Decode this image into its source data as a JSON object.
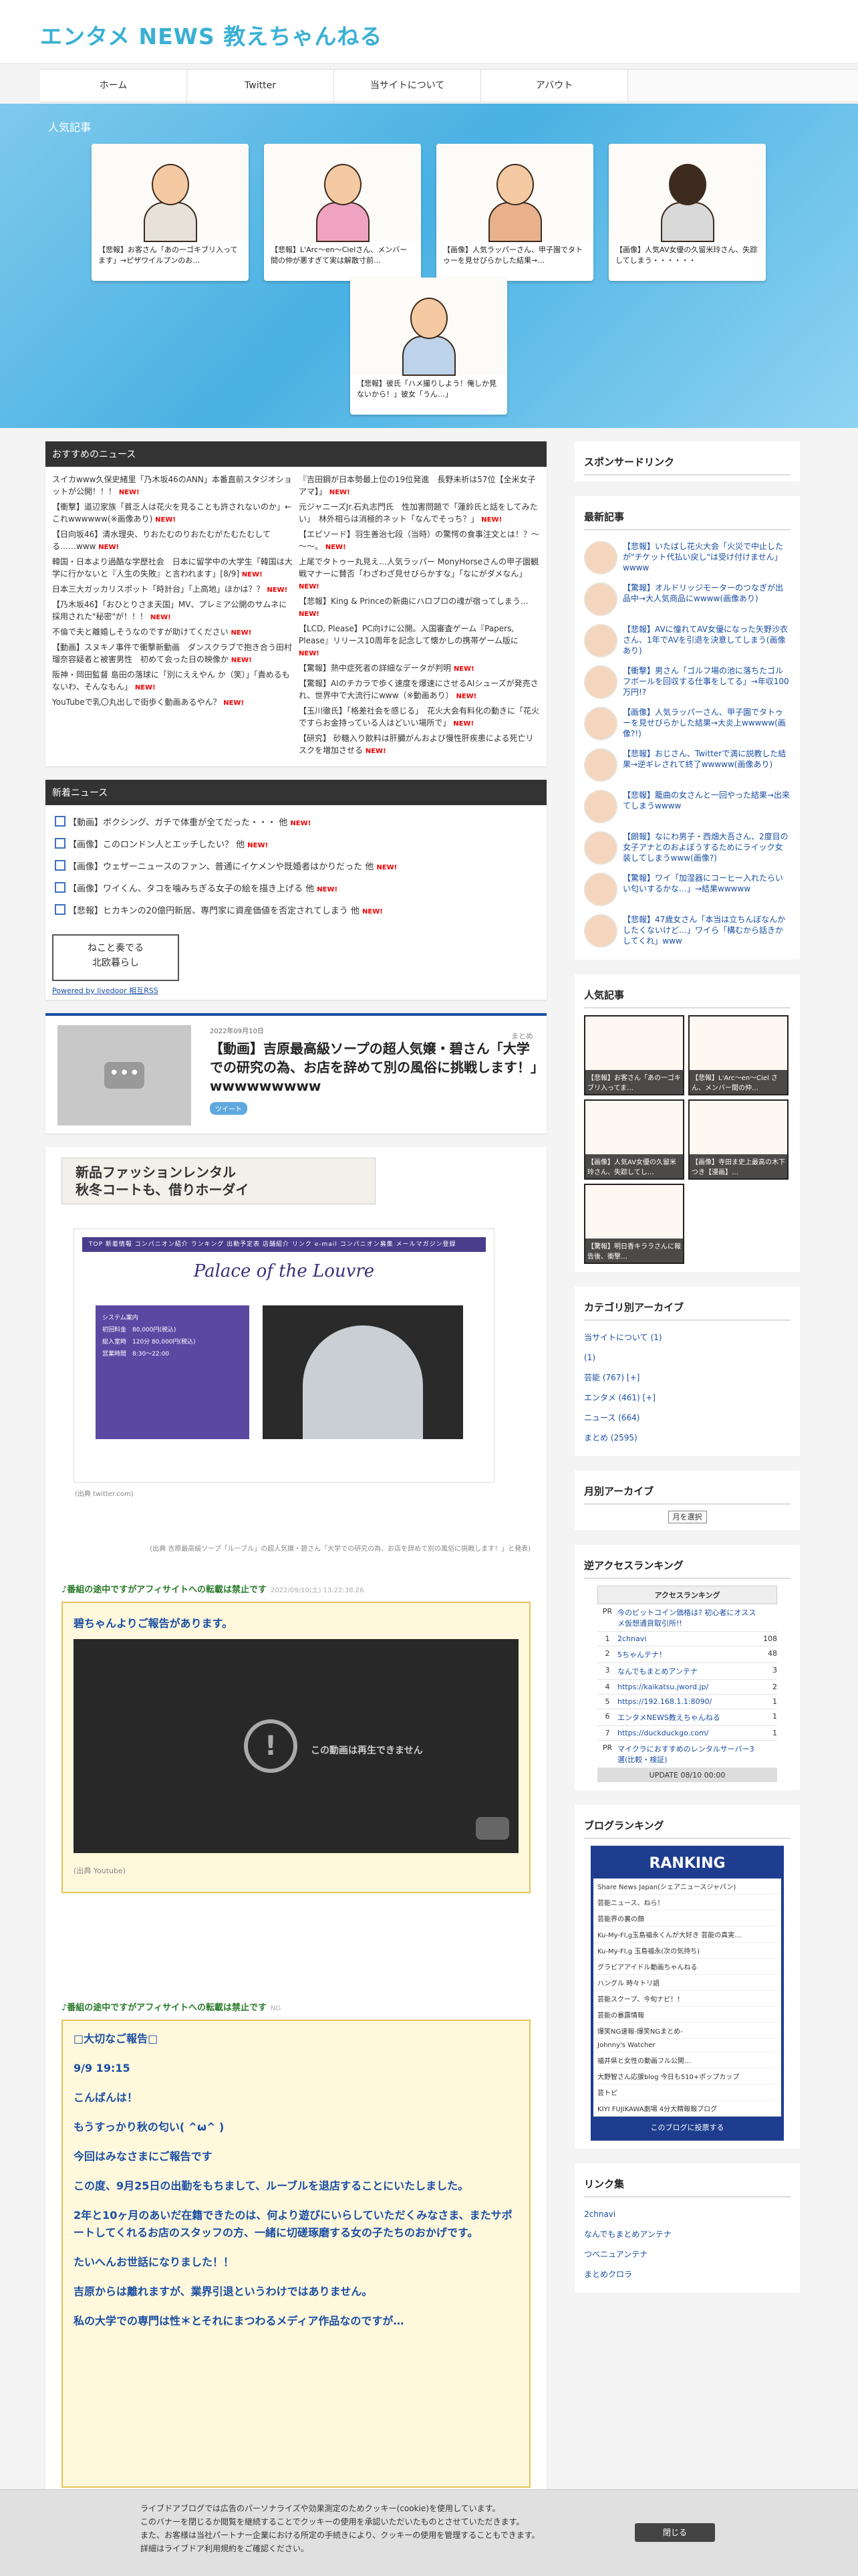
{
  "site": {
    "title": "エンタメ NEWS 教えちゃんねる"
  },
  "nav": [
    "ホーム",
    "Twitter",
    "当サイトについて",
    "アバウト"
  ],
  "hero": {
    "title": "人気記事",
    "cards": [
      "【悲報】お客さん「あの一ゴキブリ入ってます」→ピザワイルプンのお…",
      "【悲報】L'Arc～en～Cielさん、メンバー間の仲が悪すぎて実は解散寸前…",
      "【画像】人気ラッパーさん、甲子園でタトゥーを見せびらかした結果→…",
      "【画像】人気AV女優の久留米玲さん、失踪してしまう・・・・・・",
      "【悲報】彼氏「ハメ撮りしよう！俺しか見ないから！」彼女「うん…」"
    ]
  },
  "osusume": {
    "title": "おすすめのニュース",
    "col1": [
      "スイカwww久保史緒里「乃木坂46のANN」本番直前スタジオショットが公開！！！",
      "【衝撃】道辺家族「貧乏人は花火を見ることも許されないのか」←これwwwwww(※画像あり)",
      "【日向坂46】清水理央、りおたむのりおたむがたむたむしてる……www",
      "韓国・日本より過酷な学歴社会　日本に留学中の大学生「韓国は大学に行かないと『人生の失敗』と言われます」[8/9]",
      "日本三大ガッカリスポット「時計台」「上高地」ほかは？？",
      "【乃木坂46】「おひとりさま天国」MV、プレミア公開のサムネに採用された\"秘密\"が！！！",
      "不倫で夫と離婚しそうなのですが助けてください",
      "【動画】スヌキノ事件で衝撃新動画　ダンスクラブで抱き合う田村瑠奈容疑者と被害男性　初めて会った日の映像か",
      "阪神・岡田監督 島田の落球に「別にええやん か（笑）」「責めるもないわ、そんなもん」",
      "YouTubeで乳〇丸出しで街歩く動画あるやん？"
    ],
    "col2": [
      "『吉田鋼が日本勢最上位の19位発進　長野未祈は57位【全米女子アマ】」",
      "元ジャニーズJr.石丸志門氏　性加害問題で「蓮鈴氏と話をしてみたい」　林外相らは消極的ネット「なんでそっち？」",
      "【エピソード】羽生善治七段（当時）の驚愕の食事注文とは！？～～～。",
      "上尾でタトゥー丸見え…人気ラッパー MonyHorseさんの甲子園観戦マナーに賛否「わざわざ見せびらかすな」「なにがダメなん」",
      "【悲報】King & Princeの新曲にハロプロの魂が宿ってしまう…",
      "【LCD, Please】PC向けに公開。入国審査ゲーム『Papers, Please』リリース10周年を記念して懐かしの携帯ゲーム版に",
      "【驚報】熱中症死者の詳細なデータが判明",
      "【驚報】AIのチカラで歩く速度を爆速にさせるAIシューズが発売され、世界中で大流行にwww（※動画あり）",
      "【玉川徹氏】「格差社会を感じる」　花火大会有料化の動きに「花火ですらお金持っている人はどいい場所で」",
      "【研究】 砂糖入り飲料は肝臓がんおよび慢性肝疾患による死亡リスクを増加させる"
    ],
    "new_label": "NEW!"
  },
  "shinchaku": {
    "title": "新着ニュース",
    "items": [
      "【動画】ボクシング、ガチで体重が全てだった・・・ 他",
      "【画像】このロンドン人とエッチしたい？ 他",
      "【画像】ウェザーニュースのファン、普通にイケメンや既婚者はかりだった 他",
      "【画像】ワイくん、タコを噛みちぎる女子の絵を描き上げる 他",
      "【悲報】ヒカキンの20億円新居、専門家に資産価値を否定されてしまう 他"
    ],
    "banner": "ねこと奏でる\n北欧暮らし",
    "powered": "Powered by livedoor 相互RSS"
  },
  "post": {
    "date": "2022年09月10日",
    "category": "まとめ",
    "title": "【動画】吉原最高級ソープの超人気嬢・碧さん「大学での研究の為、お店を辞めて別の風俗に挑戦します！」wwwwwwwww",
    "tweet": "ツイート"
  },
  "article": {
    "ad": "新品ファッションレンタル\n秋冬コートも、借りホーダイ",
    "shot_caption": "(出典 twitter.com)",
    "shop_bar": "TOP  新着情報  コンパニオン紹介  ランキング  出勤予定表  店舗紹介  リンク  e-mail  コンパニオン募集  メールマガジン登録",
    "shop_logo": "Palace of the Louvre",
    "shop_info": "システム案内\n初回料金　80,000円(税込)\n総入室時　120分 80,000円(税込)\n営業時間　8:30～22:00",
    "caption1": "(出典 吉原最高級ソープ「ルーブル」の超人気嬢・碧さん「大学での研究の為、お店を辞めて別の風俗に挑戦します！」と発表)",
    "notice1": "♪番組の途中ですがアフィサイトへの転載は禁止です",
    "time1": "2022/09/10(土) 13:22:38.26",
    "yellow1_title": "碧ちゃんよりご報告があります。",
    "video_text": "この動画は再生できません",
    "video_src": "(出典 Youtube)",
    "notice2": "♪番組の途中ですがアフィサイトへの転載は禁止です",
    "time2": "NG",
    "yellow2": [
      "□大切なご報告□",
      "9/9 19:15",
      "こんばんは！",
      "もうすっかり秋の匂い( ^ω^ )",
      "今回はみなさまにご報告です",
      "この度、9月25日の出勤をもちまして、ルーブルを退店することにいたしました。",
      "2年と10ヶ月のあいだ在籍できたのは、何より遊びにいらしていただくみなさま、またサポートしてくれるお店のスタッフの方、一緒に切磋琢磨する女の子たちのおかげです。",
      "たいへんお世話になりました！！",
      "吉原からは離れますが、業界引退というわけではありません。",
      "私の大学での専門は性＊とそれにまつわるメディア作品なのですが…"
    ]
  },
  "sidebar": {
    "sponsor": "スポンサードリンク",
    "latest": "最新記事",
    "latest_items": [
      "【悲報】いたばし花火大会「火災で中止したが\"チケット代払い戻し\"は受け付けません」wwww",
      "【驚報】オルドリッジモーターのつなぎが出品中→大人気商品にwwww(画像あり)",
      "【悲報】AVに憧れてAV女優になった矢野沙衣さん、1年でAVを引退を決意してしまう(画像あり)",
      "【衝撃】男さん「ゴルフ場の池に落ちたゴルフボールを回収する仕事をしてる」→年収100万円!?",
      "【画像】人気ラッパーさん、甲子園でタトゥーを見せびらかした結果→大炎上wwwww(画像?!)",
      "【悲報】おじさん、Twitterで満に説教した結果→逆ギレされて終了wwwww(画像あり)",
      "【悲報】籠曲の女さんと一回やった結果→出来てしまうwwww",
      "【朗報】なにわ男子・西畑大吾さん、2度目の女子アナとのおよぼうするためにライック女装してしまうwww(画像?)",
      "【驚報】ワイ「加湿器にコーヒー入れたらいい匂いするかな…」→結果wwwww",
      "【悲報】47歳女さん「本当は立ちんぼなんかしたくないけど…」ワイら「構むから話きかしてくれ」www"
    ],
    "popular": "人気記事",
    "pop_items": [
      "【悲報】お客さん「あの一ゴキブリ入ってま…",
      "【悲報】L'Arc～en～Ciel さん、メンバー間の仲…",
      "【画像】人気AV女優の久留米玲さん、失踪してし…",
      "【画像】寺田ま史上最高の木下つき【漫画】…",
      "【驚報】明日香キララさんに報告後、衝撃…"
    ],
    "cat_title": "カテゴリ別アーカイブ",
    "cats": [
      "当サイトについて (1)",
      "(1)",
      "芸能 (767) [+]",
      "エンタメ (461) [+]",
      "ニュース (664)",
      "まとめ (2595)"
    ],
    "month_title": "月別アーカイブ",
    "month_select": "月を選択",
    "rev_title": "逆アクセスランキング",
    "rev_head": "アクセスランキング",
    "rev_items": [
      {
        "n": "PR",
        "s": "今のビットコイン価格は? 初心者にオススメ仮想通貨取引所!!",
        "v": ""
      },
      {
        "n": "1",
        "s": "2chnavi",
        "v": "108"
      },
      {
        "n": "2",
        "s": "5ちゃんテナ！",
        "v": "48"
      },
      {
        "n": "3",
        "s": "なんでもまとめアンテナ",
        "v": "3"
      },
      {
        "n": "4",
        "s": "https://kaikatsu.jword.jp/",
        "v": "2"
      },
      {
        "n": "5",
        "s": "https://192.168.1.1:8090/",
        "v": "1"
      },
      {
        "n": "6",
        "s": "エンタメNEWS教えちゃんねる",
        "v": "1"
      },
      {
        "n": "7",
        "s": "https://duckduckgo.com/",
        "v": "1"
      },
      {
        "n": "PR",
        "s": "マイクラにおすすめのレンタルサーバー3選(比較・検証)",
        "v": ""
      }
    ],
    "rev_update": "UPDATE 08/10 00:00",
    "blog_rank": "ブログランキング",
    "blog_top": "RANKING",
    "blog_rows": [
      "Share News Japan(シェアニュースジャパン)",
      "芸能ニュース、ねら！",
      "芸能界の裏の顔",
      "Ku-My-Fl,g玉島福永くんが大好き 芸能の真実…",
      "Ku-My-Fl,g 玉島福永(次の気持ち)",
      "グラビアアイドル動画ちゃんねる",
      "ハングル 時々トリ語",
      "芸能スクープ、今旬ナビ！！",
      "芸能の暴露情報",
      "爆笑NG速報-爆笑NGまとめ-",
      "Johnny's Watcher",
      "福井県と女性の動画フル公開…",
      "大野智さん応援blog 今日も510+ポップカップ",
      "芸トピ",
      "KIYI FUJIKAWA劇場 4分大精報報ブログ"
    ],
    "blog_more": "このブログに投票する",
    "links": "リンク集",
    "link_items": [
      "2chnavi",
      "なんでもまとめアンテナ",
      "つべニュアンテナ",
      "まとめクロラ"
    ]
  },
  "footer": {
    "text": [
      "ライブドアブログでは広告のパーソナライズや効果測定のためクッキー(cookie)を使用しています。",
      "このバナーを閉じるか閲覧を継続することでクッキーの使用を承認いただいたものとさせていただきます。",
      "また、お客様は当社パートナー企業における所定の手続きにより、クッキーの使用を管理することもできます。",
      "詳細はライブドア利用規約をご確認ください。"
    ],
    "close": "閉じる"
  }
}
